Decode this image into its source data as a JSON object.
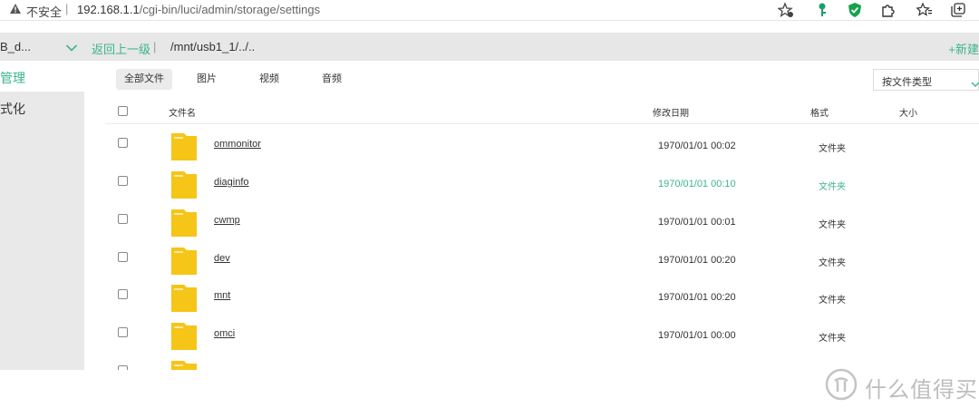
{
  "browser": {
    "security_label": "不安全",
    "separator": "|",
    "url_host": "192.168.1.1",
    "url_path": "/cgi-bin/luci/admin/storage/settings"
  },
  "toolbar": {
    "device_name": "B_d...",
    "back_label": "返回上一级",
    "separator": "|",
    "current_path": "/mnt/usb1_1/../..",
    "new_label": "+新建"
  },
  "sidebar": {
    "items": [
      {
        "label": "管理"
      },
      {
        "label": "式化"
      }
    ]
  },
  "tabs": [
    {
      "label": "全部文件"
    },
    {
      "label": "图片"
    },
    {
      "label": "视频"
    },
    {
      "label": "音频"
    }
  ],
  "filter_select": {
    "value": "按文件类型"
  },
  "table": {
    "columns": {
      "name": "文件名",
      "modified": "修改日期",
      "format": "格式",
      "size": "大小"
    },
    "rows": [
      {
        "name": "ommonitor",
        "date": "1970/01/01 00:02",
        "type": "文件夹"
      },
      {
        "name": "diaginfo",
        "date": "1970/01/01 00:10",
        "type": "文件夹"
      },
      {
        "name": "cwmp",
        "date": "1970/01/01 00:01",
        "type": "文件夹"
      },
      {
        "name": "dev",
        "date": "1970/01/01 00:20",
        "type": "文件夹"
      },
      {
        "name": "mnt",
        "date": "1970/01/01 00:20",
        "type": "文件夹"
      },
      {
        "name": "omci",
        "date": "1970/01/01 00:00",
        "type": "文件夹"
      }
    ]
  },
  "watermark": {
    "text": "什么值得买"
  },
  "colors": {
    "accent": "#3cb48e",
    "folder": "#f5c518",
    "toolbar_bg": "#e7e7e7"
  }
}
